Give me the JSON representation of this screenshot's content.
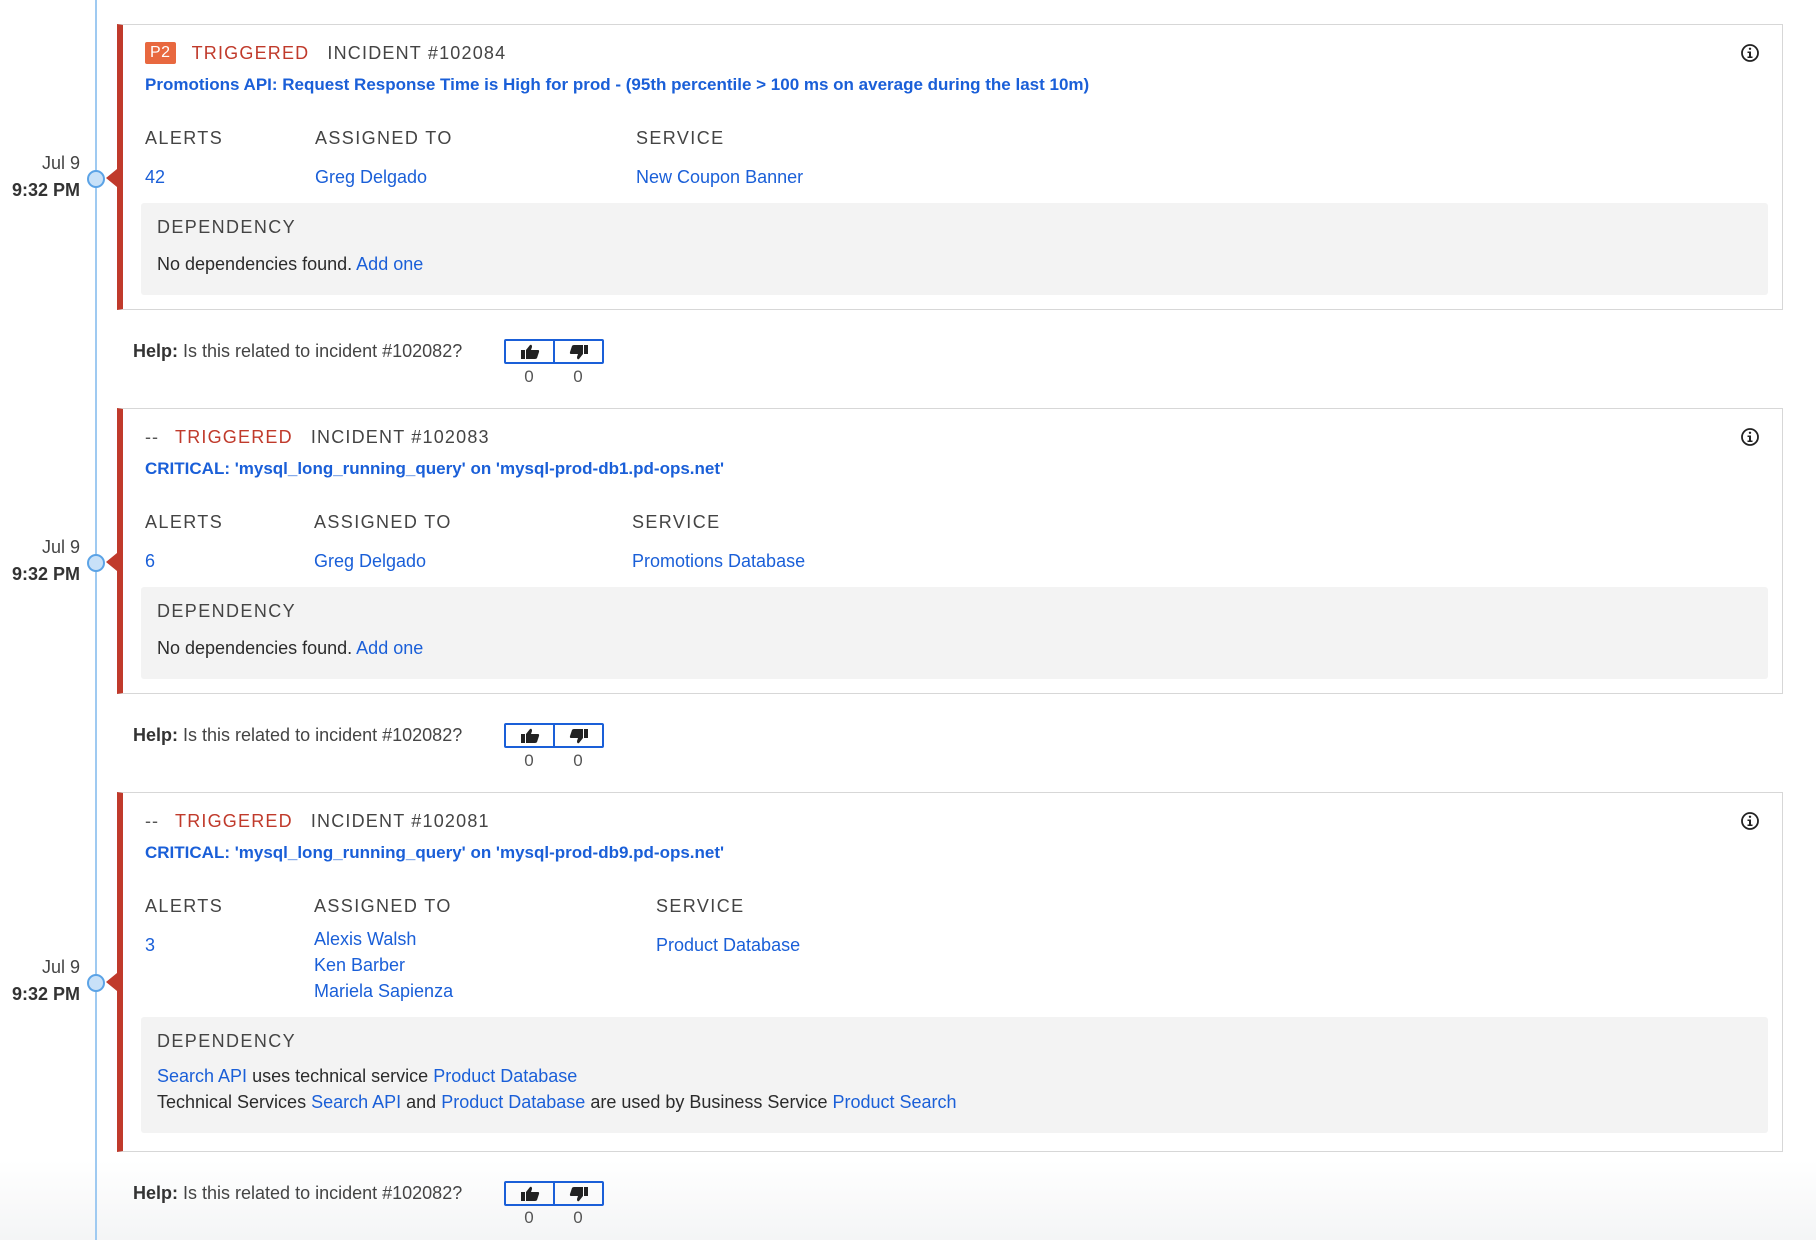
{
  "colors": {
    "accent_link": "#1a5fd8",
    "title_blue": "#1155e0",
    "triggered_red": "#c03a2b",
    "priority_orange": "#e8683f",
    "timeline_blue": "#9fcaf1"
  },
  "labels": {
    "alerts": "ALERTS",
    "assigned_to": "ASSIGNED TO",
    "service": "SERVICE",
    "dependency": "DEPENDENCY",
    "no_dependencies": "No dependencies found.",
    "add_one": "Add one",
    "help_bold": "Help:",
    "help_question": "Is this related to incident #102082?"
  },
  "incidents": [
    {
      "date": "Jul 9",
      "time": "9:32 PM",
      "priority": "P2",
      "status": "TRIGGERED",
      "incident_number": "INCIDENT #102084",
      "title": "Promotions API: Request Response Time is High for prod - (95th percentile > 100 ms on average during the last 10m)",
      "alerts": "42",
      "assignees": [
        "Greg Delgado"
      ],
      "service": "New Coupon Banner",
      "votes": {
        "up": "0",
        "down": "0"
      }
    },
    {
      "date": "Jul 9",
      "time": "9:32 PM",
      "priority": "--",
      "status": "TRIGGERED",
      "incident_number": "INCIDENT #102083",
      "title": "CRITICAL: 'mysql_long_running_query' on 'mysql-prod-db1.pd-ops.net'",
      "alerts": "6",
      "assignees": [
        "Greg Delgado"
      ],
      "service": "Promotions Database",
      "votes": {
        "up": "0",
        "down": "0"
      }
    },
    {
      "date": "Jul 9",
      "time": "9:32 PM",
      "priority": "--",
      "status": "TRIGGERED",
      "incident_number": "INCIDENT #102081",
      "title": "CRITICAL: 'mysql_long_running_query' on 'mysql-prod-db9.pd-ops.net'",
      "alerts": "3",
      "assignees": [
        "Alexis Walsh",
        "Ken Barber",
        "Mariela Sapienza"
      ],
      "service": "Product Database",
      "dependency": {
        "line1": {
          "service_a": "Search API",
          "text": "uses technical service",
          "service_b": "Product Database"
        },
        "line2": {
          "prefix": "Technical Services",
          "service_a": "Search API",
          "and": "and",
          "service_b": "Product Database",
          "text": "are used by Business Service",
          "business_service": "Product Search"
        }
      },
      "votes": {
        "up": "0",
        "down": "0"
      }
    }
  ]
}
